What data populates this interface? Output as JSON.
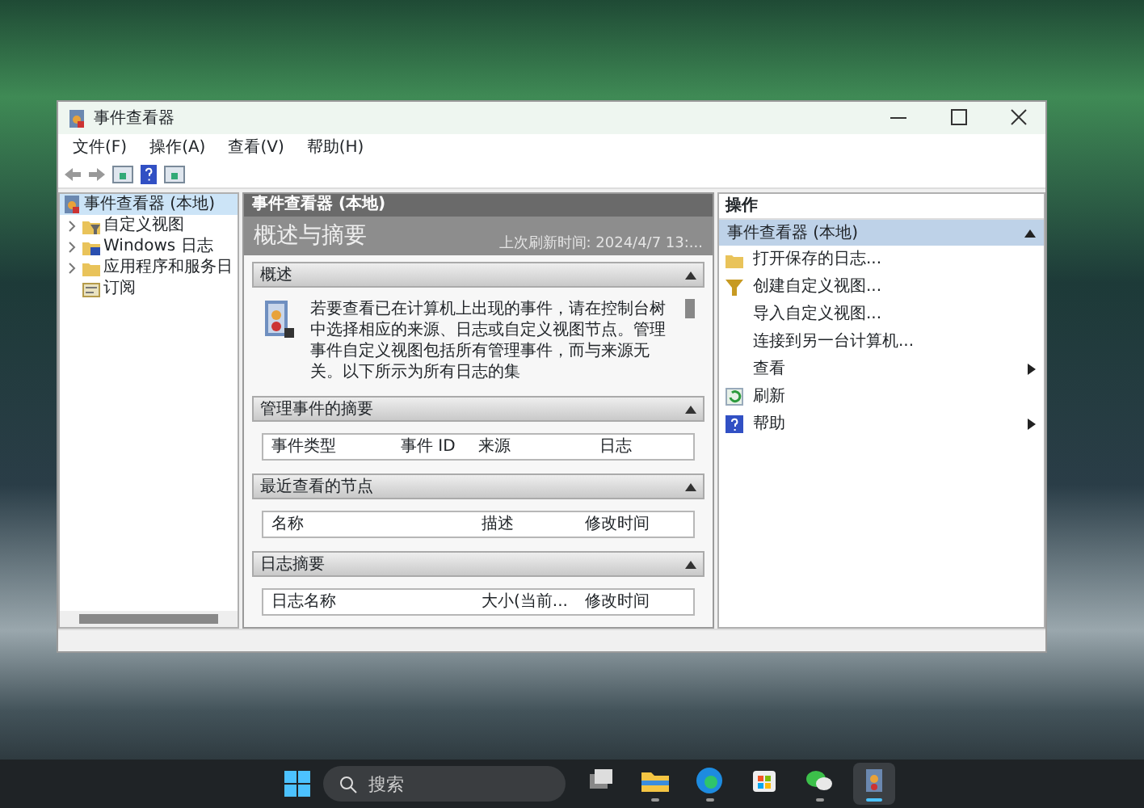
{
  "window": {
    "title": "事件查看器"
  },
  "menu": [
    {
      "label": "文件(F)"
    },
    {
      "label": "操作(A)"
    },
    {
      "label": "查看(V)"
    },
    {
      "label": "帮助(H)"
    }
  ],
  "tree": [
    {
      "label": "事件查看器 (本地)",
      "selected": true,
      "children": [
        {
          "label": "自定义视图",
          "selected": false,
          "expanded": false
        },
        {
          "label": "Windows 日志",
          "selected": false,
          "expanded": false
        },
        {
          "label": "应用程序和服务日",
          "selected": false,
          "expanded": false
        },
        {
          "label": "订阅",
          "selected": false
        }
      ]
    }
  ],
  "center": {
    "header": "事件查看器 (本地)",
    "title": "概述与摘要",
    "refreshed": "上次刷新时间: 2024/4/7 13:...",
    "sections": [
      {
        "title": "概述",
        "expanded": true,
        "kind": "text",
        "text": "若要查看已在计算机上出现的事件，请在控制台树中选择相应的来源、日志或自定义视图节点。管理事件自定义视图包括所有管理事件，而与来源无关。以下所示为所有日志的集"
      },
      {
        "title": "管理事件的摘要",
        "expanded": true,
        "kind": "table",
        "columns": [
          "事件类型",
          "事件 ID",
          "来源",
          "日志"
        ]
      },
      {
        "title": "最近查看的节点",
        "expanded": true,
        "kind": "table",
        "columns": [
          "名称",
          "描述",
          "修改时间"
        ]
      },
      {
        "title": "日志摘要",
        "expanded": true,
        "kind": "table",
        "columns": [
          "日志名称",
          "大小(当前...",
          "修改时间"
        ]
      }
    ]
  },
  "actions": {
    "title": "操作",
    "group": "事件查看器 (本地)",
    "expanded": true,
    "items": [
      {
        "label": "打开保存的日志...",
        "submenu": false
      },
      {
        "label": "创建自定义视图...",
        "submenu": false
      },
      {
        "label": "导入自定义视图...",
        "submenu": false
      },
      {
        "label": "连接到另一台计算机...",
        "submenu": false
      },
      {
        "label": "查看",
        "submenu": true
      },
      {
        "label": "刷新",
        "submenu": false
      },
      {
        "label": "帮助",
        "submenu": true
      }
    ]
  },
  "taskbar": {
    "search": {
      "placeholder": "搜索"
    },
    "apps": [
      {
        "running": false,
        "selected": false
      },
      {
        "running": true,
        "selected": false
      },
      {
        "running": true,
        "selected": false
      },
      {
        "running": false,
        "selected": false
      },
      {
        "running": true,
        "selected": false
      },
      {
        "running": true,
        "selected": true
      }
    ]
  }
}
